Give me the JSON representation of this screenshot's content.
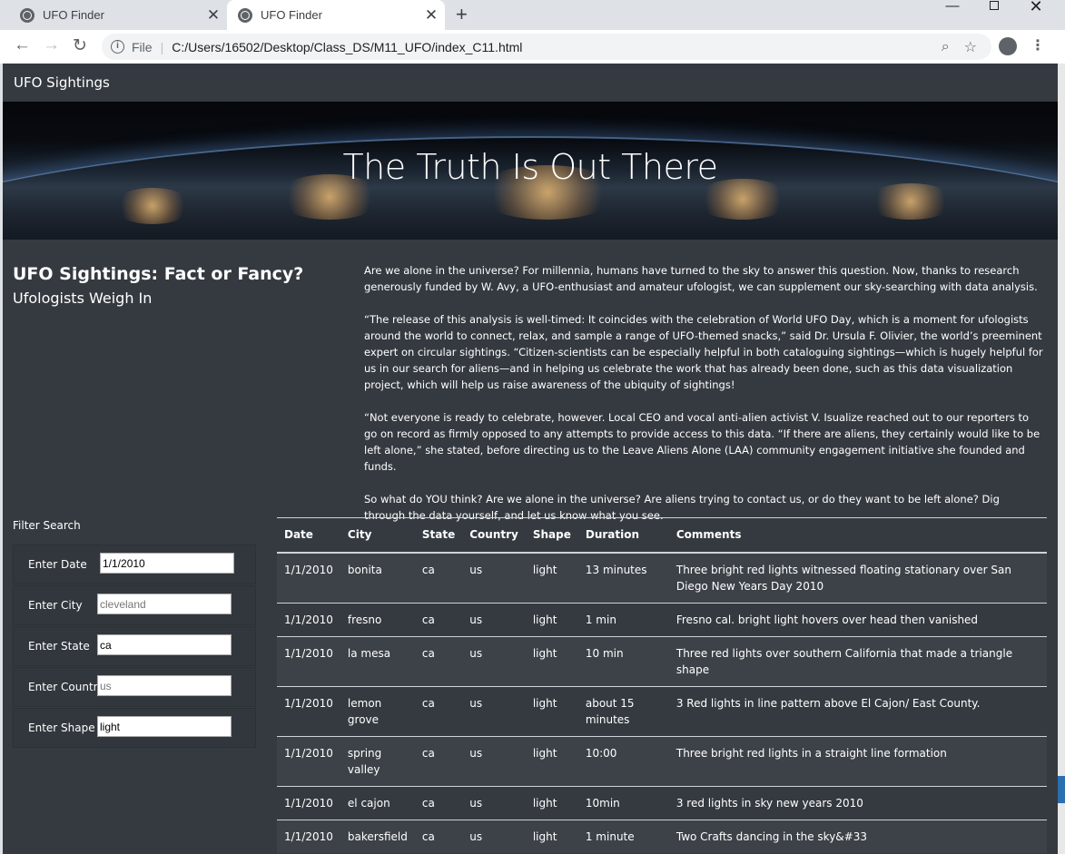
{
  "browser": {
    "tabs": [
      {
        "title": "UFO Finder"
      },
      {
        "title": "UFO Finder"
      }
    ],
    "new_tab": "+",
    "window_controls": {
      "minimize": "—",
      "close": "✕"
    },
    "nav": {
      "back": "←",
      "forward": "→",
      "reload": "↻"
    },
    "address": {
      "scheme_label": "File",
      "url": "C:/Users/16502/Desktop/Class_DS/M11_UFO/index_C11.html"
    },
    "icons": [
      "globe-icon",
      "close-icon",
      "info-icon",
      "zoom-icon",
      "star-icon",
      "account-icon",
      "menu-icon"
    ]
  },
  "navbar": {
    "brand": "UFO Sightings"
  },
  "hero": {
    "title": "The Truth Is Out There"
  },
  "headline": {
    "title": "UFO Sightings: Fact or Fancy?",
    "subtitle": "Ufologists Weigh In"
  },
  "article": [
    "Are we alone in the universe? For millennia, humans have turned to the sky to answer this question. Now, thanks to research generously funded by W. Avy, a UFO-enthusiast and amateur ufologist, we can supplement our sky-searching with data analysis.",
    "“The release of this analysis is well-timed: It coincides with the celebration of World UFO Day, which is a moment for ufologists around the world to connect, relax, and sample a range of UFO-themed snacks,” said Dr. Ursula F. Olivier, the world’s preeminent expert on circular sightings. “Citizen-scientists can be especially helpful in both cataloguing sightings—which is hugely helpful for us in our search for aliens—and in helping us celebrate the work that has already been done, such as this data visualization project, which will help us raise awareness of the ubiquity of sightings!",
    "“Not everyone is ready to celebrate, however. Local CEO and vocal anti-alien activist V. Isualize reached out to our reporters to go on record as firmly opposed to any attempts to provide access to this data. “If there are aliens, they certainly would like to be left alone,” she stated, before directing us to the Leave Aliens Alone (LAA) community engagement initiative she founded and funds.",
    "So what do YOU think? Are we alone in the universe? Are aliens trying to contact us, or do they want to be left alone? Dig through the data yourself, and let us know what you see."
  ],
  "filters": {
    "title": "Filter Search",
    "items": [
      {
        "label": "Enter Date",
        "value": "1/1/2010",
        "placeholder": ""
      },
      {
        "label": "Enter City",
        "value": "",
        "placeholder": "cleveland"
      },
      {
        "label": "Enter State",
        "value": "ca",
        "placeholder": ""
      },
      {
        "label": "Enter Country",
        "value": "",
        "placeholder": "us"
      },
      {
        "label": "Enter Shape",
        "value": "light",
        "placeholder": ""
      }
    ]
  },
  "table": {
    "headers": [
      "Date",
      "City",
      "State",
      "Country",
      "Shape",
      "Duration",
      "Comments"
    ],
    "rows": [
      [
        "1/1/2010",
        "bonita",
        "ca",
        "us",
        "light",
        "13 minutes",
        "Three bright red lights witnessed floating stationary over San Diego New Years Day 2010"
      ],
      [
        "1/1/2010",
        "fresno",
        "ca",
        "us",
        "light",
        "1 min",
        "Fresno cal. bright light hovers over head then vanished"
      ],
      [
        "1/1/2010",
        "la mesa",
        "ca",
        "us",
        "light",
        "10 min",
        "Three red lights over southern California that made a triangle shape"
      ],
      [
        "1/1/2010",
        "lemon grove",
        "ca",
        "us",
        "light",
        "about 15 minutes",
        "3 Red lights in line pattern above El Cajon/ East County."
      ],
      [
        "1/1/2010",
        "spring valley",
        "ca",
        "us",
        "light",
        "10:00",
        "Three bright red lights in a straight line formation"
      ],
      [
        "1/1/2010",
        "el cajon",
        "ca",
        "us",
        "light",
        "10min",
        "3 red lights in sky new years 2010"
      ],
      [
        "1/1/2010",
        "bakersfield",
        "ca",
        "us",
        "light",
        "1 minute",
        "Two Crafts dancing in the sky&#33"
      ]
    ]
  },
  "colors": {
    "page_bg": "#353a40",
    "navbar_bg": "#343a40",
    "text": "#ffffff",
    "row_stripe": "#3d4248"
  }
}
